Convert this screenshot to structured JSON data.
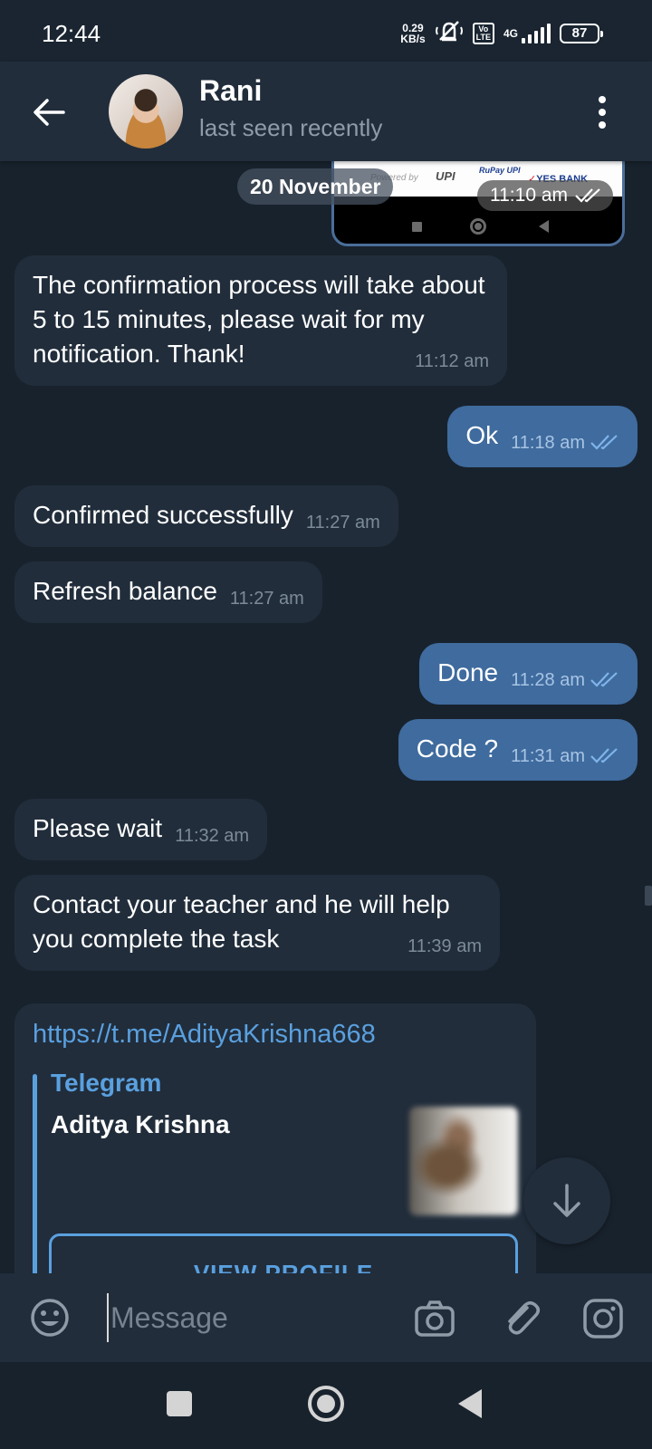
{
  "status_bar": {
    "time": "12:44",
    "speed_value": "0.29",
    "speed_unit": "KB/s",
    "volte_top": "Vo",
    "volte_bottom": "LTE",
    "network": "4G",
    "battery": "87"
  },
  "header": {
    "name": "Rani",
    "status": "last seen recently"
  },
  "chat": {
    "top_image": {
      "powered_by": "Powered by",
      "upi": "UPI",
      "rupay": "RuPay UPI",
      "yes_bank": "YES BANK",
      "time": "11:10 am"
    },
    "date_separator": "20 November",
    "messages": [
      {
        "direction": "in",
        "text": "The confirmation process will take about 5 to 15 minutes, please wait for my notification. Thank!",
        "time": "11:12 am"
      },
      {
        "direction": "out",
        "text": "Ok",
        "time": "11:18 am",
        "read": true
      },
      {
        "direction": "in",
        "text": "Confirmed successfully",
        "time": "11:27 am"
      },
      {
        "direction": "in",
        "text": "Refresh balance",
        "time": "11:27 am"
      },
      {
        "direction": "out",
        "text": "Done",
        "time": "11:28 am",
        "read": true
      },
      {
        "direction": "out",
        "text": "Code ?",
        "time": "11:31 am",
        "read": true
      },
      {
        "direction": "in",
        "text": "Please wait",
        "time": "11:32 am"
      },
      {
        "direction": "in",
        "text": "Contact your teacher and he will help you complete the task",
        "time": "11:39 am"
      }
    ],
    "link_message": {
      "url": "https://t.me/AdityaKrishna668",
      "site_name": "Telegram",
      "title": "Aditya Krishna",
      "button": "VIEW PROFILE"
    }
  },
  "input_bar": {
    "placeholder": "Message"
  },
  "colors": {
    "background": "#18222d",
    "incoming_bubble": "#212d3b",
    "outgoing_bubble": "#3f6b9e",
    "link": "#5aa0df"
  },
  "icons": [
    "back-arrow-icon",
    "more-vert-icon",
    "emoji-icon",
    "camera-icon",
    "attach-icon",
    "instagram-icon",
    "arrow-down-icon"
  ]
}
